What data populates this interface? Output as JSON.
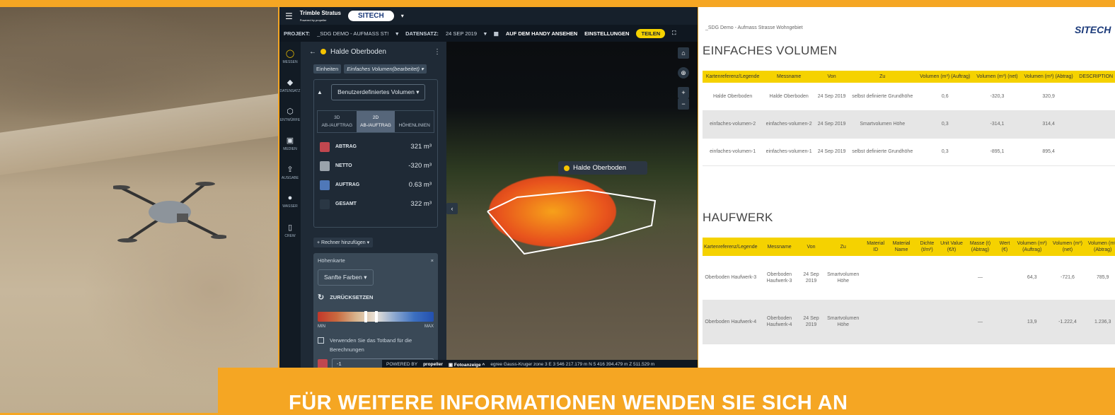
{
  "app": {
    "brand": "Trimble Stratus",
    "brand_sub": "Powered by propeller",
    "company": "SITECH",
    "bar": {
      "project_label": "PROJEKT:",
      "project_value": "_SDG DEMO - AUFMASS ST!",
      "dataset_label": "DATENSATZ:",
      "dataset_value": "24 SEP 2019",
      "phone_view": "AUF DEM HANDY ANSEHEN",
      "settings": "EINSTELLUNGEN",
      "share": "TEILEN"
    },
    "rail": [
      {
        "label": "MESSEN",
        "icon": "measure-icon"
      },
      {
        "label": "DATENSATZ",
        "icon": "layers-icon"
      },
      {
        "label": "ENTWÜRFE",
        "icon": "cube-icon"
      },
      {
        "label": "MEDIEN",
        "icon": "image-icon"
      },
      {
        "label": "AUSGABE",
        "icon": "export-icon"
      },
      {
        "label": "WASSER",
        "icon": "water-icon"
      },
      {
        "label": "CREW",
        "icon": "phone-icon"
      }
    ],
    "panel": {
      "title": "Halde Oberboden",
      "tag_units": "Einheiten",
      "tag_type": "Einfaches Volumen(bearbeitet) ▾",
      "volume_type": "Benutzerdefiniertes Volumen",
      "tabs": [
        {
          "line1": "3D",
          "line2": "AB-/AUFTRAG"
        },
        {
          "line1": "2D",
          "line2": "AB-/AUFTRAG"
        },
        {
          "line1": "",
          "line2": "HÖHENLINIEN"
        }
      ],
      "values": [
        {
          "label": "ABTRAG",
          "value": "321 m³",
          "color": "#c0474f"
        },
        {
          "label": "NETTO",
          "value": "-320 m³",
          "color": "#9aa3ab"
        },
        {
          "label": "AUFTRAG",
          "value": "0.63 m³",
          "color": "#4f78b8"
        },
        {
          "label": "GESAMT",
          "value": "322 m³",
          "color": "#2a3744"
        }
      ],
      "add_calc": "+ Rechner hinzufügen ▾",
      "heatmap": {
        "title": "Höhenkarte",
        "palette": "Sanfte Farben",
        "reset": "ZURÜCKSETZEN",
        "min": "MIN",
        "max": "MAX",
        "deadband": "Verwenden Sie das Totband für die Berechnungen",
        "input_value": "-1",
        "input_unit": "m"
      }
    },
    "view": {
      "label": "Halde Oberboden",
      "status_powered": "POWERED BY",
      "status_propeller": "propeller",
      "status_photo": "Fotoanzeige",
      "status_coords": "egree Gauss-Kruger zone 3  E  3 546 217.179 m  N  5 416 394.479 m  Z  511.529 m"
    }
  },
  "report": {
    "header": "_SDG Demo - Aufmass Strasse Wohngebiet",
    "logo": "SITECH",
    "section1": "EINFACHES VOLUMEN",
    "table1": {
      "headers": [
        "Kartenreferenz/Legende",
        "Messname",
        "Von",
        "Zu",
        "Volumen (m³) (Auftrag)",
        "Volumen (m³) (net)",
        "Volumen (m³) (Abtrag)",
        "DESCRIPTION"
      ],
      "rows": [
        [
          "Halde Oberboden",
          "Halde Oberboden",
          "24 Sep 2019",
          "selbst definierte Grundhöhe",
          "0,6",
          "-320,3",
          "320,9",
          ""
        ],
        [
          "einfaches-volumen-2",
          "einfaches-volumen-2",
          "24 Sep 2019",
          "Smartvolumen Höhe",
          "0,3",
          "-314,1",
          "314,4",
          ""
        ],
        [
          "einfaches-volumen-1",
          "einfaches-volumen-1",
          "24 Sep 2019",
          "selbst definierte Grundhöhe",
          "0,3",
          "-895,1",
          "895,4",
          ""
        ]
      ]
    },
    "section2": "HAUFWERK",
    "table2": {
      "headers": [
        "Kartenreferenz/Legende",
        "Messname",
        "Von",
        "Zu",
        "Material ID",
        "Material Name",
        "Dichte (t/m³)",
        "Unit Value (€/t)",
        "Masse (t) (Abtrag)",
        "Wert (€)",
        "Volumen (m³) (Auftrag)",
        "Volumen (m³) (net)",
        "Volumen (m³) (Abtrag)"
      ],
      "rows": [
        [
          "Oberboden Haufwerk-3",
          "Oberboden Haufwerk-3",
          "24 Sep 2019",
          "Smartvolumen Höhe",
          "",
          "",
          "",
          "",
          "—",
          "",
          "64,3",
          "-721,6",
          "785,9"
        ],
        [
          "Oberboden Haufwerk-4",
          "Oberboden Haufwerk-4",
          "24 Sep 2019",
          "Smartvolumen Höhe",
          "",
          "",
          "",
          "",
          "—",
          "",
          "13,9",
          "-1.222,4",
          "1.236,3"
        ]
      ]
    }
  },
  "banner": "FÜR WEITERE INFORMATIONEN WENDEN SIE SICH AN"
}
